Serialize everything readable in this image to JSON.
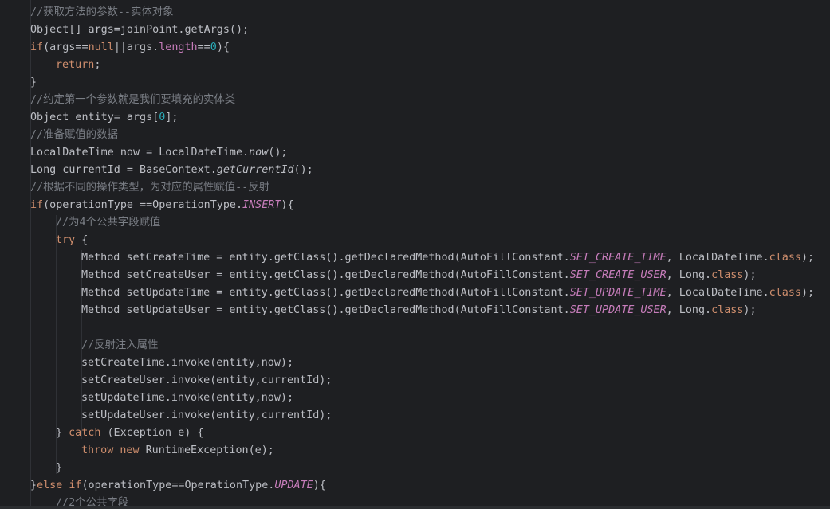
{
  "editor": {
    "lines": [
      [
        {
          "t": "//获取方法的参数--实体对象",
          "c": "cm"
        }
      ],
      [
        {
          "t": "Object[] args=joinPoint.getArgs();",
          "c": ""
        }
      ],
      [
        {
          "t": "if",
          "c": "kw"
        },
        {
          "t": "(args==",
          "c": ""
        },
        {
          "t": "null",
          "c": "kw"
        },
        {
          "t": "||args.",
          "c": ""
        },
        {
          "t": "length",
          "c": "fld"
        },
        {
          "t": "==",
          "c": ""
        },
        {
          "t": "0",
          "c": "num"
        },
        {
          "t": "){",
          "c": ""
        }
      ],
      [
        {
          "t": "return",
          "c": "kw"
        },
        {
          "t": ";",
          "c": ""
        }
      ],
      [
        {
          "t": "}",
          "c": ""
        }
      ],
      [
        {
          "t": "//约定第一个参数就是我们要填充的实体类",
          "c": "cm"
        }
      ],
      [
        {
          "t": "Object entity= args[",
          "c": ""
        },
        {
          "t": "0",
          "c": "num"
        },
        {
          "t": "];",
          "c": ""
        }
      ],
      [
        {
          "t": "//准备赋值的数据",
          "c": "cm"
        }
      ],
      [
        {
          "t": "LocalDateTime now = LocalDateTime.",
          "c": ""
        },
        {
          "t": "now",
          "c": "it"
        },
        {
          "t": "();",
          "c": ""
        }
      ],
      [
        {
          "t": "Long currentId = BaseContext.",
          "c": ""
        },
        {
          "t": "getCurrentId",
          "c": "it"
        },
        {
          "t": "();",
          "c": ""
        }
      ],
      [
        {
          "t": "//根据不同的操作类型，为对应的属性赋值--反射",
          "c": "cm"
        }
      ],
      [
        {
          "t": "if",
          "c": "kw"
        },
        {
          "t": "(operationType ==OperationType.",
          "c": ""
        },
        {
          "t": "INSERT",
          "c": "cst"
        },
        {
          "t": "){",
          "c": ""
        }
      ],
      [
        {
          "t": "//为4个公共字段赋值",
          "c": "cm"
        }
      ],
      [
        {
          "t": "try",
          "c": "kw"
        },
        {
          "t": " {",
          "c": ""
        }
      ],
      [
        {
          "t": "Method setCreateTime = entity.getClass().getDeclaredMethod(AutoFillConstant.",
          "c": ""
        },
        {
          "t": "SET_CREATE_TIME",
          "c": "cst"
        },
        {
          "t": ", LocalDateTime.",
          "c": ""
        },
        {
          "t": "class",
          "c": "kw"
        },
        {
          "t": ");",
          "c": ""
        }
      ],
      [
        {
          "t": "Method setCreateUser = entity.getClass().getDeclaredMethod(AutoFillConstant.",
          "c": ""
        },
        {
          "t": "SET_CREATE_USER",
          "c": "cst"
        },
        {
          "t": ", Long.",
          "c": ""
        },
        {
          "t": "class",
          "c": "kw"
        },
        {
          "t": ");",
          "c": ""
        }
      ],
      [
        {
          "t": "Method setUpdateTime = entity.getClass().getDeclaredMethod(AutoFillConstant.",
          "c": ""
        },
        {
          "t": "SET_UPDATE_TIME",
          "c": "cst"
        },
        {
          "t": ", LocalDateTime.",
          "c": ""
        },
        {
          "t": "class",
          "c": "kw"
        },
        {
          "t": ");",
          "c": ""
        }
      ],
      [
        {
          "t": "Method setUpdateUser = entity.getClass().getDeclaredMethod(AutoFillConstant.",
          "c": ""
        },
        {
          "t": "SET_UPDATE_USER",
          "c": "cst"
        },
        {
          "t": ", Long.",
          "c": ""
        },
        {
          "t": "class",
          "c": "kw"
        },
        {
          "t": ");",
          "c": ""
        }
      ],
      [],
      [
        {
          "t": "//反射注入属性",
          "c": "cm"
        }
      ],
      [
        {
          "t": "setCreateTime.invoke(entity,now);",
          "c": ""
        }
      ],
      [
        {
          "t": "setCreateUser.invoke(entity,currentId);",
          "c": ""
        }
      ],
      [
        {
          "t": "setUpdateTime.invoke(entity,now);",
          "c": ""
        }
      ],
      [
        {
          "t": "setUpdateUser.invoke(entity,currentId);",
          "c": ""
        }
      ],
      [
        {
          "t": "} ",
          "c": ""
        },
        {
          "t": "catch",
          "c": "kw"
        },
        {
          "t": " (Exception e) {",
          "c": ""
        }
      ],
      [
        {
          "t": "throw new",
          "c": "kw"
        },
        {
          "t": " RuntimeException(e);",
          "c": ""
        }
      ],
      [
        {
          "t": "}",
          "c": ""
        }
      ],
      [
        {
          "t": "}",
          "c": ""
        },
        {
          "t": "else if",
          "c": "kw"
        },
        {
          "t": "(operationType==OperationType.",
          "c": ""
        },
        {
          "t": "UPDATE",
          "c": "cst"
        },
        {
          "t": "){",
          "c": ""
        }
      ],
      [
        {
          "t": "//2个公共字段",
          "c": "cm"
        }
      ]
    ]
  }
}
